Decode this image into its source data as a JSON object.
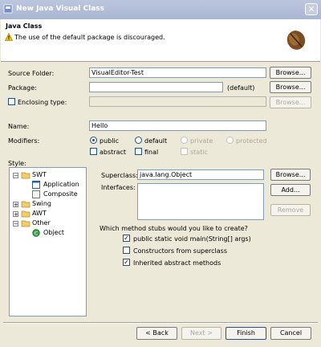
{
  "window": {
    "title": "New Java Visual Class",
    "close_glyph": "✕"
  },
  "banner": {
    "title": "Java Class",
    "message": "The use of the default package is discouraged."
  },
  "form": {
    "source_folder_label": "Source Folder:",
    "source_folder_value": "VisualEditor-Test",
    "package_label": "Package:",
    "package_value": "",
    "package_suffix": "(default)",
    "enclosing_label": "Enclosing type:",
    "enclosing_value": "",
    "browse": "Browse...",
    "name_label": "Name:",
    "name_value": "Hello",
    "modifiers_label": "Modifiers:",
    "modifiers": {
      "public": "public",
      "default": "default",
      "private": "private",
      "protected": "protected",
      "abstract": "abstract",
      "final": "final",
      "static": "static"
    },
    "style_label": "Style:"
  },
  "tree": {
    "items": [
      {
        "label": "SWT",
        "expanded": true
      },
      {
        "label": "Application"
      },
      {
        "label": "Composite"
      },
      {
        "label": "Swing",
        "expanded": false
      },
      {
        "label": "AWT",
        "expanded": false
      },
      {
        "label": "Other",
        "expanded": true
      },
      {
        "label": "Object"
      }
    ]
  },
  "right": {
    "superclass_label": "Superclass:",
    "superclass_value": "java.lang.Object",
    "interfaces_label": "Interfaces:",
    "browse": "Browse...",
    "add": "Add...",
    "remove": "Remove",
    "stubs_question": "Which method stubs would you like to create?",
    "stubs": [
      {
        "label": "public static void main(String[] args)",
        "checked": true
      },
      {
        "label": "Constructors from superclass",
        "checked": false
      },
      {
        "label": "Inherited abstract methods",
        "checked": true
      }
    ]
  },
  "footer": {
    "back": "< Back",
    "next": "Next >",
    "finish": "Finish",
    "cancel": "Cancel"
  },
  "colors": {
    "title_bar": "#bcc6de",
    "dialog_bg": "#ece9d8",
    "field_border": "#7f9db9"
  }
}
